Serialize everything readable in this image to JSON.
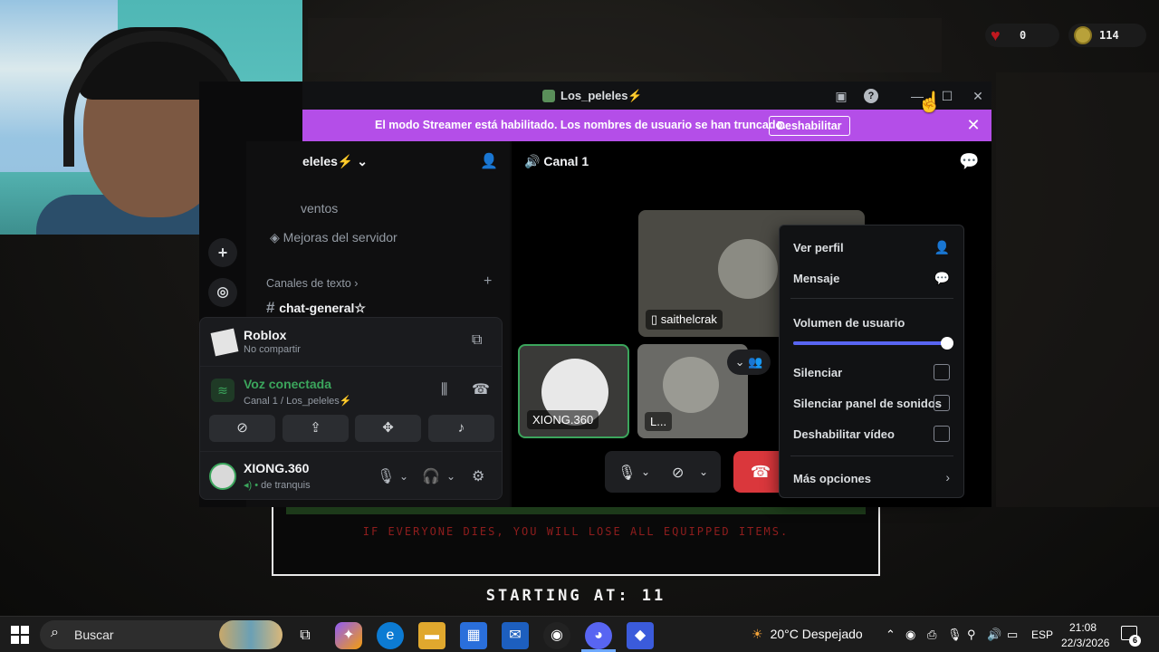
{
  "game": {
    "hearts_value": "0",
    "coins_value": "114",
    "warning": "IF EVERYONE DIES, YOU WILL LOSE ALL EQUIPPED ITEMS.",
    "countdown": "STARTING AT: 11"
  },
  "discord": {
    "window_title": "Los_peleles⚡",
    "streamer_banner": {
      "text": "El modo Streamer está habilitado. Los nombres de usuario se han truncado.",
      "button": "Deshabilitar"
    },
    "server_name": "eleles⚡",
    "sidebar": {
      "events": "ventos",
      "server_boosts": "Mejoras del servidor",
      "text_channels_header": "Canales de texto",
      "channel": "chat-general☆"
    },
    "activity": {
      "title": "Roblox",
      "subtitle": "No compartir"
    },
    "voice": {
      "status": "Voz conectada",
      "location": "Canal 1 / Los_peleles⚡"
    },
    "account": {
      "username": "XIONG.360",
      "status": "de tranquis"
    },
    "call": {
      "channel": "Canal 1",
      "tiles": [
        {
          "label": "saithelcrak"
        },
        {
          "label": "XIONG.360"
        },
        {
          "label": "L..."
        }
      ]
    },
    "context_menu": {
      "view_profile": "Ver perfil",
      "message": "Mensaje",
      "user_volume": "Volumen de usuario",
      "volume_level": 1.0,
      "mute": "Silenciar",
      "mute_soundboard": "Silenciar panel de sonidos",
      "disable_video": "Deshabilitar vídeo",
      "more_options": "Más opciones"
    }
  },
  "taskbar": {
    "search_placeholder": "Buscar",
    "weather": "20°C  Despejado",
    "language": "ESP",
    "time": "21:08",
    "date": "22/3/2026",
    "notifications": "6"
  },
  "colors": {
    "streamer_banner": "#b44ee8",
    "voice_connected": "#3ba55c",
    "hangup": "#da373c",
    "slider": "#5865f2"
  }
}
